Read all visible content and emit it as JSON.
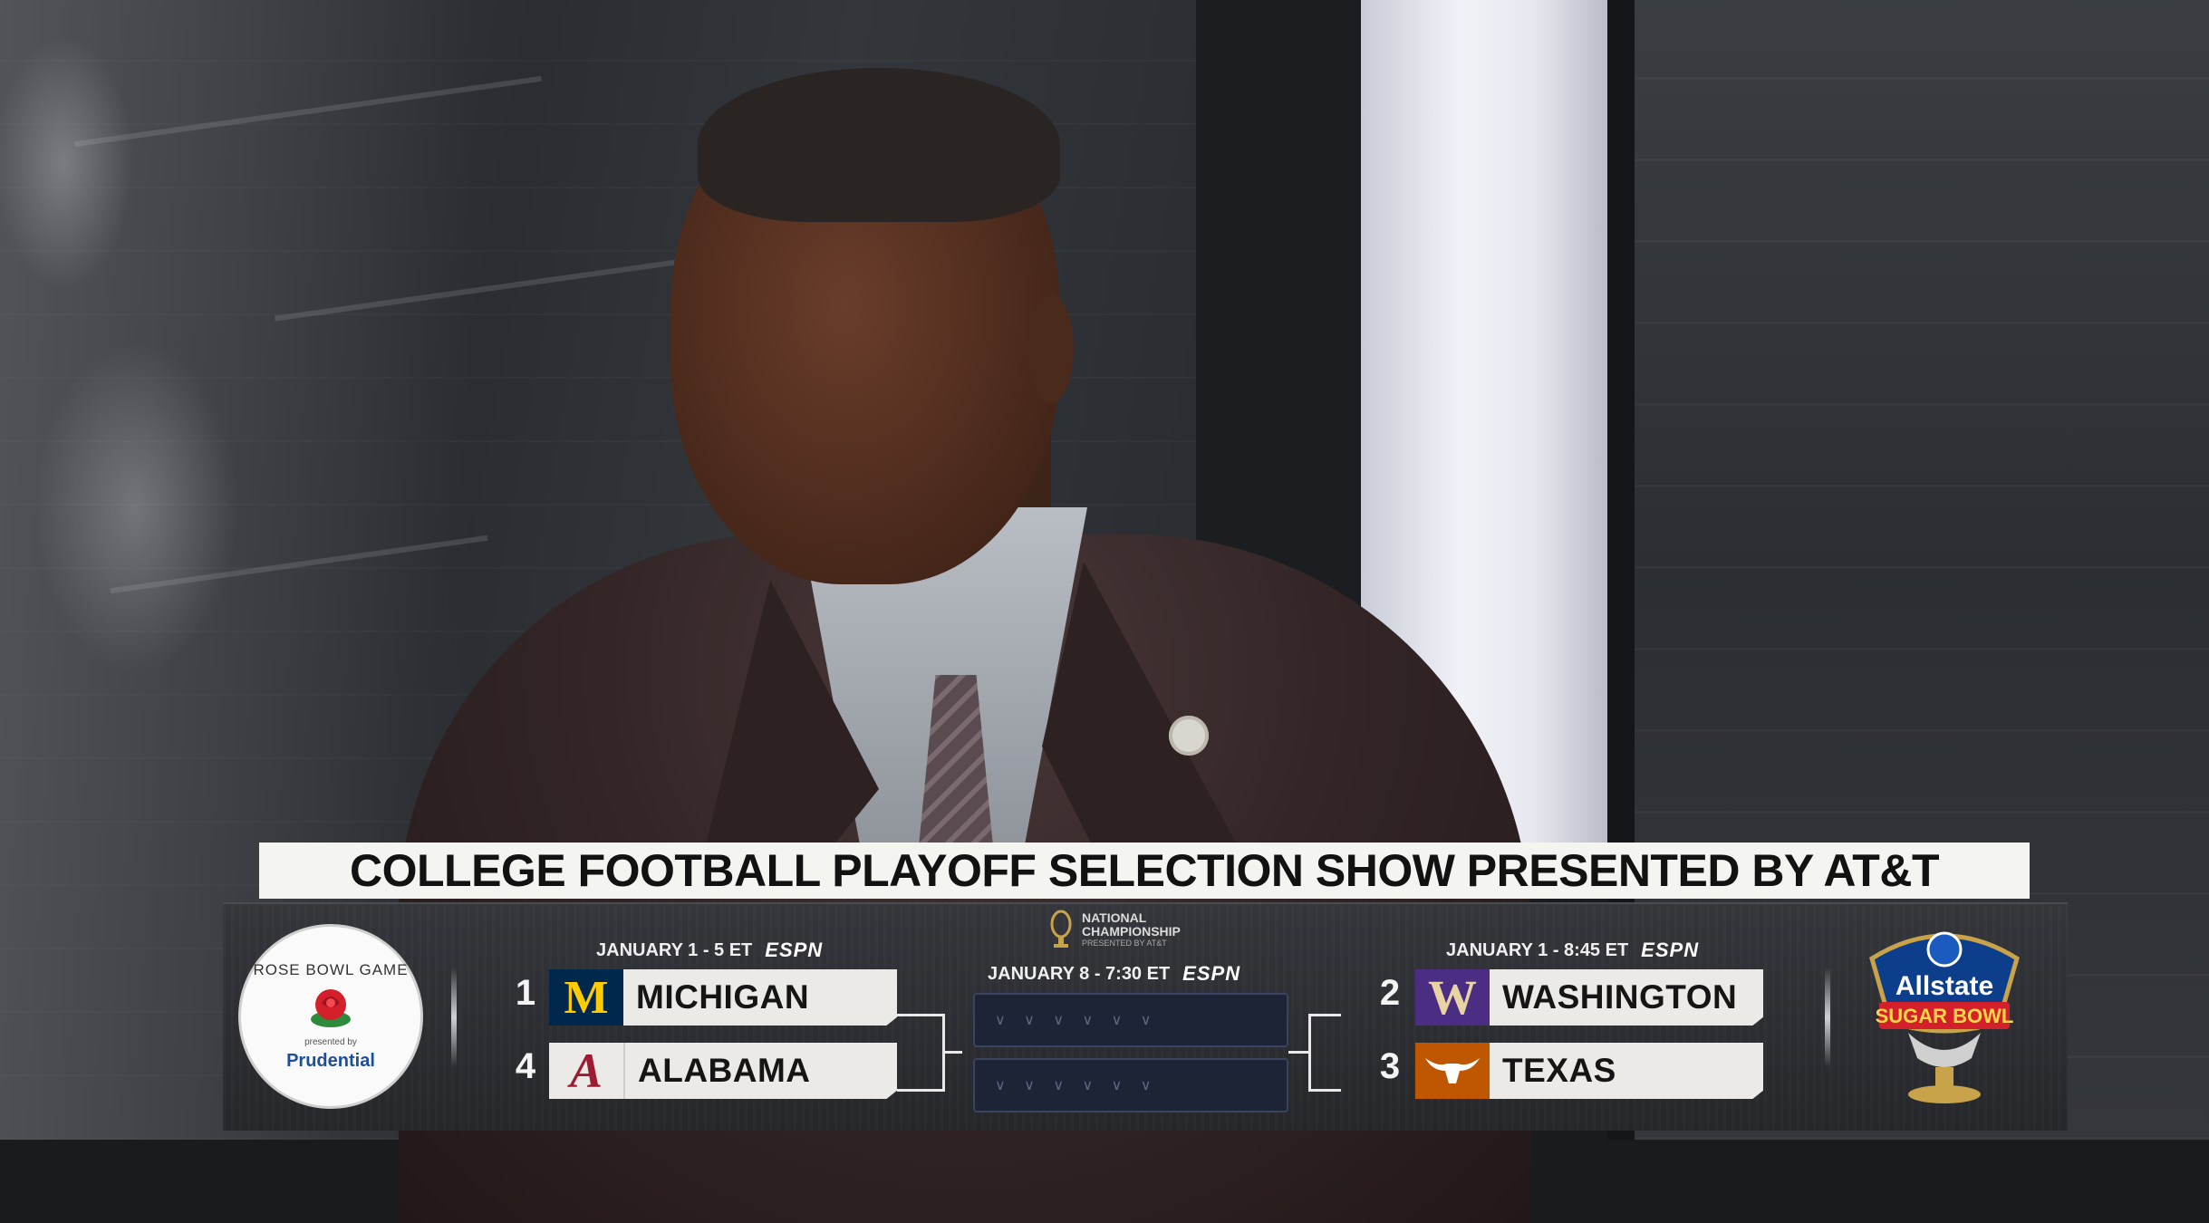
{
  "headline": "COLLEGE FOOTBALL PLAYOFF SELECTION SHOW PRESENTED BY AT&T",
  "network": "ESPN",
  "left_bowl": {
    "name": "ROSE BOWL GAME",
    "presented_by": "presented by",
    "sponsor": "Prudential",
    "date": "JANUARY 1 - 5 ET",
    "teams": [
      {
        "seed": "1",
        "name": "MICHIGAN",
        "logo": "M",
        "logo_color": "#00274c",
        "logo_accent": "#ffcb05"
      },
      {
        "seed": "4",
        "name": "ALABAMA",
        "logo": "A",
        "logo_color": "#eceae6",
        "logo_accent": "#9e1b32"
      }
    ]
  },
  "championship": {
    "line1": "NATIONAL",
    "line2": "CHAMPIONSHIP",
    "line3": "PRESENTED BY AT&T",
    "date": "JANUARY 8 - 7:30 ET",
    "slots": [
      "∨ ∨ ∨ ∨ ∨ ∨",
      "∨ ∨ ∨ ∨ ∨ ∨"
    ]
  },
  "right_bowl": {
    "name": "Allstate SUGAR BOWL",
    "sponsor": "Allstate",
    "bowl": "SUGAR BOWL",
    "date": "JANUARY 1 - 8:45 ET",
    "teams": [
      {
        "seed": "2",
        "name": "WASHINGTON",
        "logo": "W",
        "logo_color": "#4b2e83",
        "logo_accent": "#e8d3a2"
      },
      {
        "seed": "3",
        "name": "TEXAS",
        "logo": "longhorn",
        "logo_color": "#bf5700",
        "logo_accent": "#ffffff"
      }
    ]
  },
  "icons": {
    "rose": "rose-icon",
    "trophy": "cfp-trophy-icon",
    "sugar_bowl": "sugar-bowl-trophy-icon",
    "longhorn": "longhorn-icon"
  }
}
